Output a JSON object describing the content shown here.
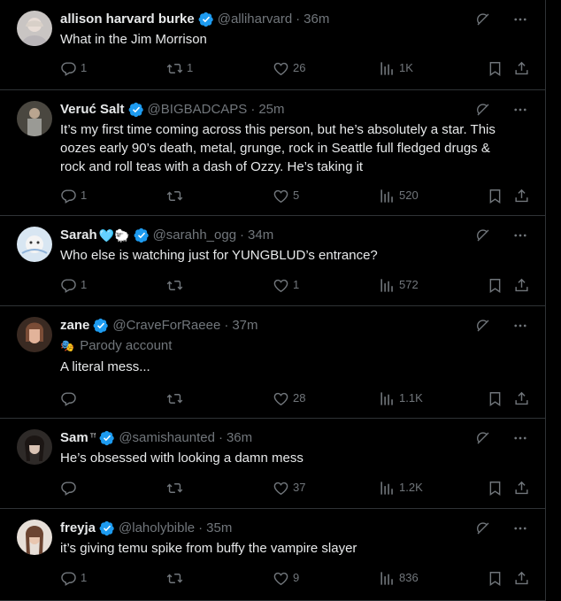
{
  "colors": {
    "background": "#000000",
    "text": "#e7e9ea",
    "muted": "#71767b",
    "verified": "#1d9bf0",
    "divider": "#2f3336"
  },
  "tweets": [
    {
      "name": "allison harvard burke",
      "handle": "@alliharvard",
      "time": "36m",
      "text": "What in the Jim Morrison",
      "replies": "1",
      "retweets": "1",
      "likes": "26",
      "views": "1K",
      "avatar_icon": "woman-portrait-avatar"
    },
    {
      "name": "Veruć Salt",
      "handle": "@BIGBADCAPS",
      "time": "25m",
      "text": "It’s my first time coming across this person, but he’s absolutely a star. This oozes early 90’s death, metal, grunge, rock in Seattle full fledged drugs & rock and roll teas with a dash of Ozzy. He’s taking it",
      "replies": "1",
      "retweets": "",
      "likes": "5",
      "views": "520",
      "avatar_icon": "person-in-suit-avatar"
    },
    {
      "name": "Sarah",
      "name_emoji": "🩵🐑",
      "handle": "@sarahh_ogg",
      "time": "34m",
      "text": "Who else is watching just for YUNGBLUD’s entrance?",
      "replies": "1",
      "retweets": "",
      "likes": "1",
      "views": "572",
      "avatar_icon": "cartoon-illustration-avatar"
    },
    {
      "name": "zane",
      "handle": "@CraveForRaeee",
      "time": "37m",
      "parody": "Parody account",
      "parody_icon": "mask-icon",
      "text": "A literal mess...",
      "replies": "",
      "retweets": "",
      "likes": "28",
      "views": "1.1K",
      "avatar_icon": "selfie-avatar"
    },
    {
      "name": "Sam",
      "name_emoji": "ᵀᶠ",
      "handle": "@samishaunted",
      "time": "36m",
      "text": "He’s obsessed with looking a damn mess",
      "replies": "",
      "retweets": "",
      "likes": "37",
      "views": "1.2K",
      "avatar_icon": "dark-haired-avatar"
    },
    {
      "name": "freyja",
      "handle": "@laholybible",
      "time": "35m",
      "text": "it’s giving temu spike from buffy the vampire slayer",
      "replies": "1",
      "retweets": "",
      "likes": "9",
      "views": "836",
      "avatar_icon": "brunette-portrait-avatar"
    }
  ],
  "dot": "·"
}
